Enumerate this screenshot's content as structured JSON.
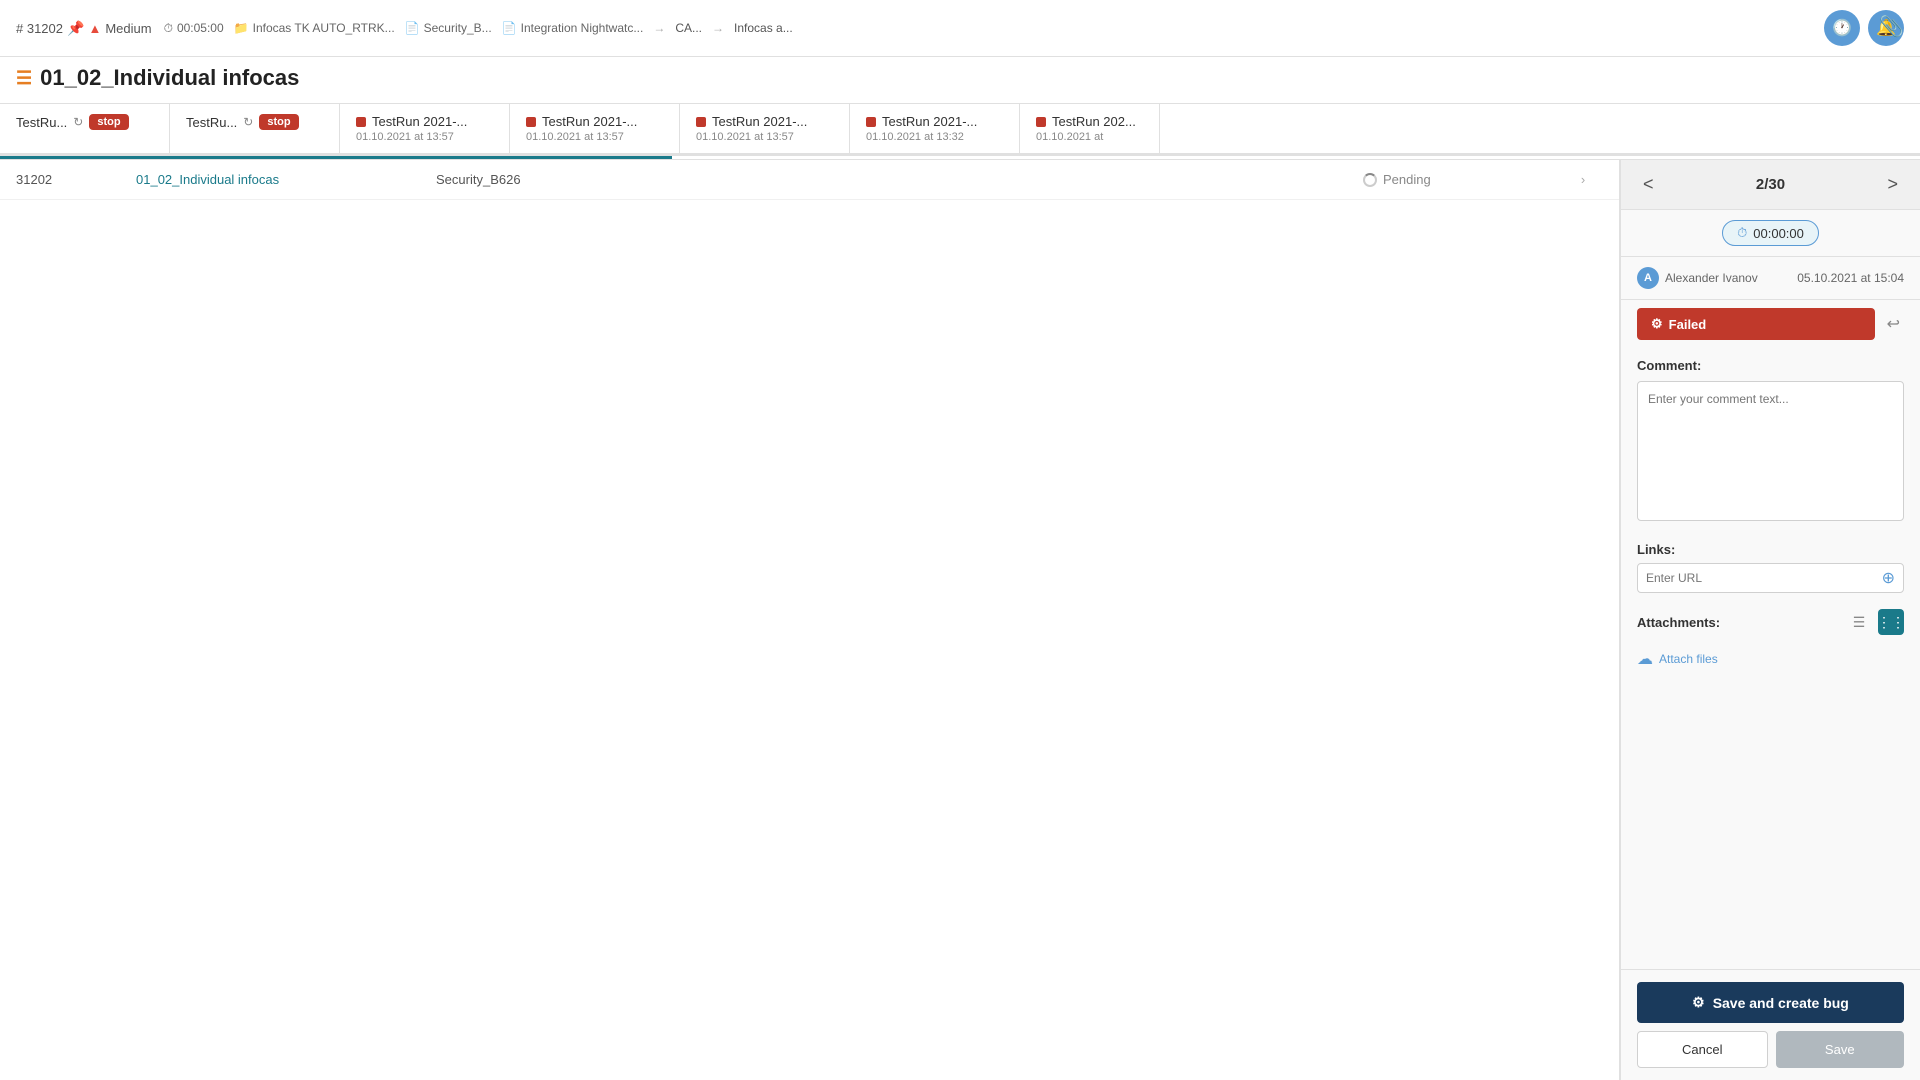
{
  "header": {
    "issue_number": "# 31202",
    "priority": "Medium",
    "duration": "00:05:00",
    "project": "Infocas TK AUTO_RTRK...",
    "suite1": "Security_B...",
    "suite2": "Integration Nightwatc...",
    "breadcrumb1": "CA...",
    "breadcrumb2": "Infocas a...",
    "clock_btn_label": "clock",
    "bell_btn_label": "bell",
    "attach_btn_label": "attach"
  },
  "page_title": "01_02_Individual infocas",
  "tabs": [
    {
      "name": "TestRu...",
      "type": "active_stop",
      "date": ""
    },
    {
      "name": "TestRu...",
      "type": "stop",
      "date": ""
    },
    {
      "name": "TestRun 2021-...",
      "type": "failed",
      "date": "01.10.2021 at 13:57"
    },
    {
      "name": "TestRun 2021-...",
      "type": "failed",
      "date": "01.10.2021 at 13:57"
    },
    {
      "name": "TestRun 2021-...",
      "type": "failed",
      "date": "01.10.2021 at 13:57"
    },
    {
      "name": "TestRun 2021-...",
      "type": "failed",
      "date": "01.10.2021 at 13:32"
    },
    {
      "name": "TestRun 202...",
      "type": "failed",
      "date": "01.10.2021 at"
    }
  ],
  "data_row": {
    "id": "31202",
    "title": "01_02_Individual infocas",
    "suite": "Security_B626",
    "status": "Pending"
  },
  "right_panel": {
    "nav": {
      "prev_label": "<",
      "next_label": ">",
      "counter": "2/30"
    },
    "timer": "00:00:00",
    "user": {
      "name": "Alexander Ivanov",
      "timestamp": "05.10.2021 at 15:04",
      "avatar_initials": "A"
    },
    "status": {
      "label": "Failed",
      "icon": "gear"
    },
    "comment": {
      "label": "Comment:",
      "placeholder": "Enter your comment text..."
    },
    "links": {
      "label": "Links:",
      "url_placeholder": "Enter URL"
    },
    "attachments": {
      "label": "Attachments:",
      "attach_files_label": "Attach files"
    },
    "buttons": {
      "save_bug_label": "Save and create bug",
      "cancel_label": "Cancel",
      "save_label": "Save"
    }
  },
  "progress_percent": 35
}
